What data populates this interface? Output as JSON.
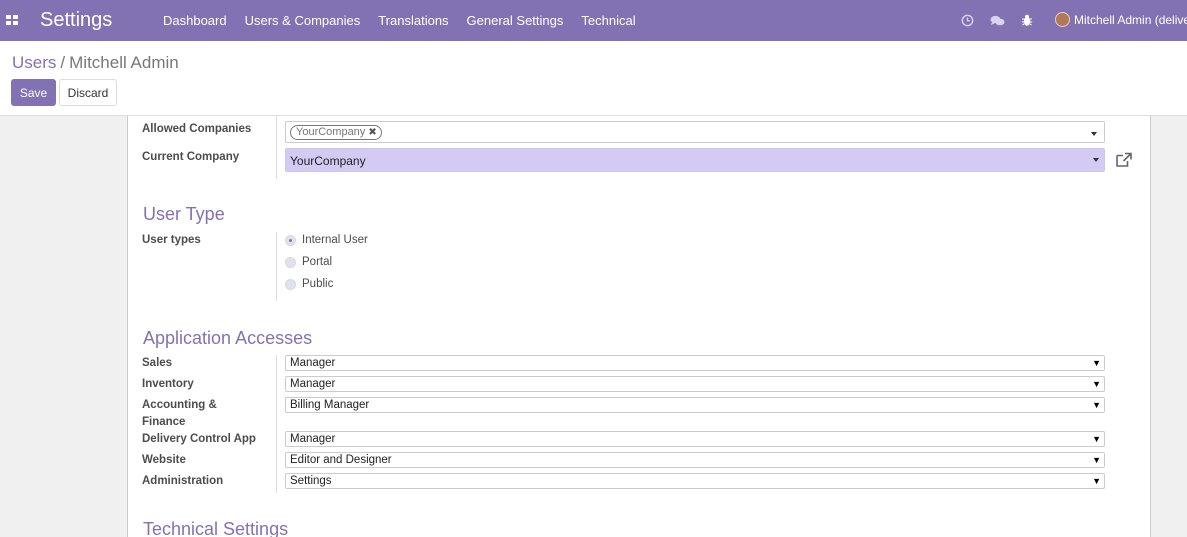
{
  "navbar": {
    "brand": "Settings",
    "menu": [
      "Dashboard",
      "Users & Companies",
      "Translations",
      "General Settings",
      "Technical"
    ],
    "user": "Mitchell Admin (delive"
  },
  "breadcrumb": {
    "parent": "Users",
    "separator": "/",
    "current": "Mitchell Admin"
  },
  "actions": {
    "save": "Save",
    "discard": "Discard"
  },
  "companies": {
    "allowed_label": "Allowed Companies",
    "allowed_tag": "YourCompany",
    "current_label": "Current Company",
    "current_value": "YourCompany"
  },
  "user_type": {
    "title": "User Type",
    "label": "User types",
    "options": [
      "Internal User",
      "Portal",
      "Public"
    ],
    "selected": "Internal User"
  },
  "app_access": {
    "title": "Application Accesses",
    "rows": [
      {
        "label": "Sales",
        "value": "Manager"
      },
      {
        "label": "Inventory",
        "value": "Manager"
      },
      {
        "label": "Accounting & Finance",
        "value": "Billing Manager"
      },
      {
        "label": "Delivery Control App",
        "value": "Manager"
      },
      {
        "label": "Website",
        "value": "Editor and Designer"
      },
      {
        "label": "Administration",
        "value": "Settings"
      }
    ]
  },
  "technical": {
    "title": "Technical Settings"
  },
  "colors": {
    "brand": "#8372b3",
    "selected_field": "#d4cbf5"
  },
  "icons": [
    "apps-icon",
    "clock-icon",
    "chat-icon",
    "bug-icon",
    "remove-tag-icon",
    "external-link-icon",
    "caret-down-icon"
  ]
}
